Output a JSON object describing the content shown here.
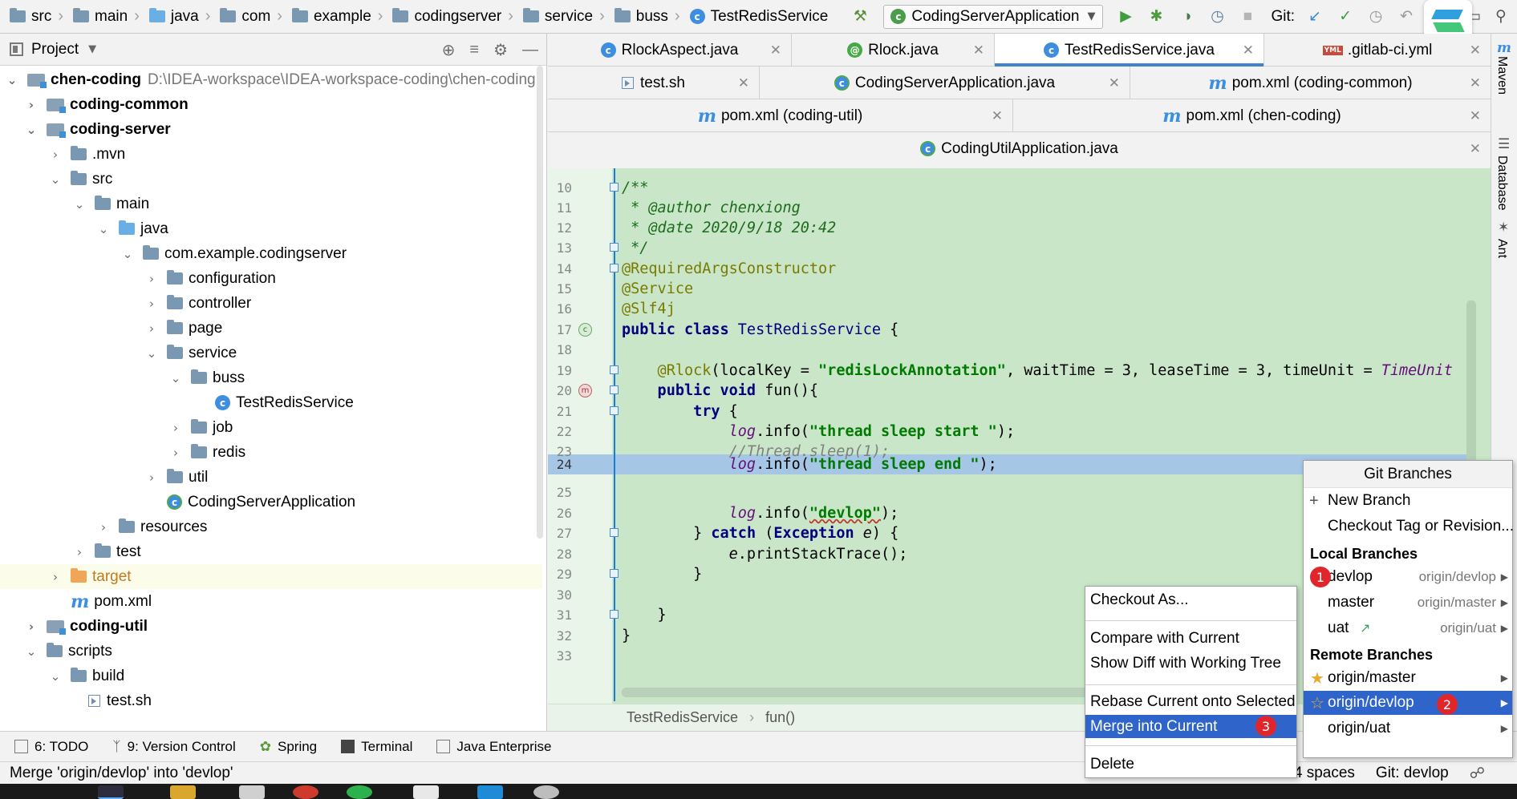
{
  "breadcrumbs": [
    "src",
    "main",
    "java",
    "com",
    "example",
    "codingserver",
    "service",
    "buss",
    "TestRedisService"
  ],
  "run_config": "CodingServerApplication",
  "git_label": "Git:",
  "project_panel": {
    "title": "Project",
    "tree": [
      {
        "label": "chen-coding",
        "path": "D:\\IDEA-workspace\\IDEA-workspace-coding\\chen-coding"
      },
      {
        "label": "coding-common"
      },
      {
        "label": "coding-server"
      },
      {
        "label": ".mvn"
      },
      {
        "label": "src"
      },
      {
        "label": "main"
      },
      {
        "label": "java"
      },
      {
        "label": "com.example.codingserver"
      },
      {
        "label": "configuration"
      },
      {
        "label": "controller"
      },
      {
        "label": "page"
      },
      {
        "label": "service"
      },
      {
        "label": "buss"
      },
      {
        "label": "TestRedisService"
      },
      {
        "label": "job"
      },
      {
        "label": "redis"
      },
      {
        "label": "util"
      },
      {
        "label": "CodingServerApplication"
      },
      {
        "label": "resources"
      },
      {
        "label": "test"
      },
      {
        "label": "target"
      },
      {
        "label": "pom.xml"
      },
      {
        "label": "coding-util"
      },
      {
        "label": "scripts"
      },
      {
        "label": "build"
      },
      {
        "label": "test.sh"
      }
    ]
  },
  "tabs": {
    "row1": [
      "RlockAspect.java",
      "Rlock.java",
      "TestRedisService.java",
      ".gitlab-ci.yml"
    ],
    "row2": [
      "test.sh",
      "CodingServerApplication.java",
      "pom.xml (coding-common)"
    ],
    "row3": [
      "pom.xml (coding-util)",
      "pom.xml (chen-coding)"
    ],
    "row4": [
      "CodingUtilApplication.java"
    ]
  },
  "editor": {
    "line_numbers": [
      "10",
      "11",
      "12",
      "13",
      "14",
      "15",
      "16",
      "17",
      "18",
      "19",
      "20",
      "21",
      "22",
      "23",
      "24",
      "25",
      "26",
      "27",
      "28",
      "29",
      "30",
      "31",
      "32",
      "33"
    ],
    "code": {
      "l10": "/**",
      "l11a": " * @author ",
      "l11b": "chenxiong",
      "l12a": " * @date ",
      "l12b": "2020/9/18 20:42",
      "l13": " */",
      "l14": "@RequiredArgsConstructor",
      "l15": "@Service",
      "l16": "@Slf4j",
      "l17a": "public class ",
      "l17b": "TestRedisService",
      "l17c": " {",
      "l19a": "    @Rlock",
      "l19b": "(localKey = ",
      "l19c": "\"redisLockAnnotation\"",
      "l19d": ", waitTime = 3, leaseTime = 3, timeUnit = ",
      "l19e": "TimeUnit",
      "l20a": "    public void ",
      "l20b": "fun(){",
      "l21a": "        try",
      "l21b": " {",
      "l22a": "            log",
      "l22b": ".info(",
      "l22c": "\"thread sleep start \"",
      "l22d": ");",
      "l23": "            //Thread.sleep(1);",
      "l24a": "            log",
      "l24b": ".info(",
      "l24c": "\"thread sleep end \"",
      "l24d": ");",
      "l26a": "            log",
      "l26b": ".info(",
      "l26c": "\"devlop\"",
      "l26d": ");",
      "l27a": "        } ",
      "l27b": "catch",
      "l27c": " (",
      "l27d": "Exception",
      "l27e": " e",
      "l27f": ") {",
      "l28a": "            e",
      "l28b": ".printStackTrace();",
      "l29": "        }",
      "l31": "    }",
      "l32": "}"
    },
    "breadcrumb": [
      "TestRedisService",
      "fun()"
    ]
  },
  "right_tools": [
    "Maven",
    "Database",
    "Ant"
  ],
  "bottom_tools": [
    "6: TODO",
    "9: Version Control",
    "Spring",
    "Terminal",
    "Java Enterprise"
  ],
  "status": {
    "message": "Merge 'origin/devlop' into 'devlop'",
    "indent": "4 spaces",
    "git_branch": "Git: devlop"
  },
  "context_menu": {
    "items": [
      "Checkout As...",
      "Compare with Current",
      "Show Diff with Working Tree",
      "Rebase Current onto Selected",
      "Merge into Current",
      "Delete"
    ],
    "selected": "Merge into Current"
  },
  "git_branches": {
    "title": "Git Branches",
    "new_branch": "New Branch",
    "checkout_tag": "Checkout Tag or Revision...",
    "local_header": "Local Branches",
    "local": [
      {
        "name": "devlop",
        "tracking": "origin/devlop"
      },
      {
        "name": "master",
        "tracking": "origin/master"
      },
      {
        "name": "uat",
        "tracking": "origin/uat"
      }
    ],
    "remote_header": "Remote Branches",
    "remote": [
      "origin/master",
      "origin/devlop",
      "origin/uat"
    ]
  },
  "badges": [
    "1",
    "2",
    "3"
  ],
  "colors": {
    "selection": "#2f65ca",
    "editor_bg": "#c9e6c9",
    "current_line": "#a6c6e6",
    "badge": "#e0262a"
  }
}
